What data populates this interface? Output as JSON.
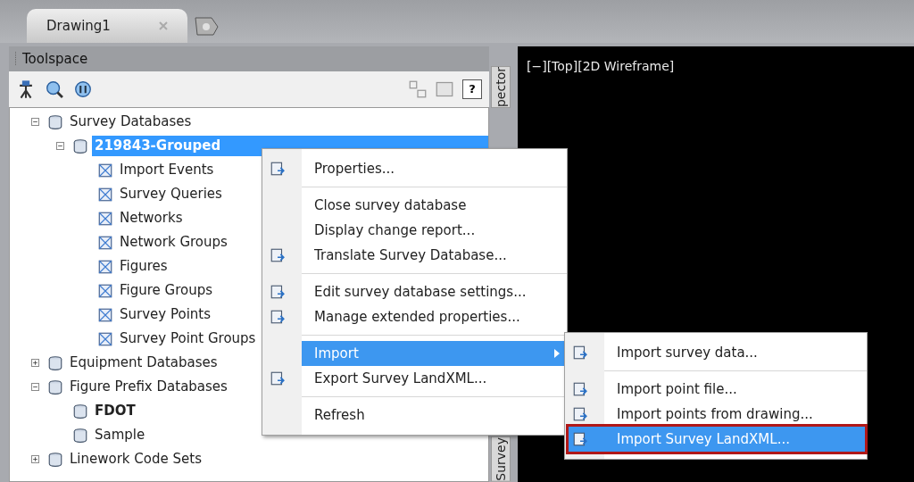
{
  "tabs": [
    {
      "label": "Drawing1",
      "selected": true
    }
  ],
  "toolspace": {
    "title": "Toolspace",
    "help": "?",
    "tree": [
      {
        "label": "Survey Databases",
        "expanded": true,
        "selected": false,
        "children": [
          {
            "label": "219843-Grouped",
            "expanded": true,
            "selected": true,
            "children": [
              {
                "label": "Import Events",
                "selected": false
              },
              {
                "label": "Survey Queries",
                "selected": false
              },
              {
                "label": "Networks",
                "selected": false
              },
              {
                "label": "Network Groups",
                "selected": false
              },
              {
                "label": "Figures",
                "selected": false
              },
              {
                "label": "Figure Groups",
                "selected": false
              },
              {
                "label": "Survey Points",
                "selected": false
              },
              {
                "label": "Survey Point Groups",
                "selected": false
              }
            ]
          }
        ]
      },
      {
        "label": "Equipment Databases",
        "expanded": false,
        "selected": false
      },
      {
        "label": "Figure Prefix Databases",
        "expanded": true,
        "selected": false,
        "children": [
          {
            "label": "FDOT",
            "selected": false,
            "current": true
          },
          {
            "label": "Sample",
            "selected": false,
            "current": false
          }
        ]
      },
      {
        "label": "Linework Code Sets",
        "expanded": false,
        "selected": false
      }
    ]
  },
  "side_tabs": [
    "pector",
    "Survey"
  ],
  "viewport": {
    "label": "[−][Top][2D Wireframe]"
  },
  "context_menu": {
    "groups": [
      [
        {
          "label": "Properties...",
          "selected": false,
          "submenu": false
        }
      ],
      [
        {
          "label": "Close survey database",
          "selected": false,
          "submenu": false
        },
        {
          "label": "Display change report...",
          "selected": false,
          "submenu": false
        },
        {
          "label": "Translate Survey Database...",
          "selected": false,
          "submenu": false
        }
      ],
      [
        {
          "label": "Edit survey database settings...",
          "selected": false,
          "submenu": false
        },
        {
          "label": "Manage extended properties...",
          "selected": false,
          "submenu": false
        }
      ],
      [
        {
          "label": "Import",
          "selected": true,
          "submenu": true
        },
        {
          "label": "Export Survey LandXML...",
          "selected": false,
          "submenu": false
        }
      ],
      [
        {
          "label": "Refresh",
          "selected": false,
          "submenu": false
        }
      ]
    ]
  },
  "submenu": {
    "groups": [
      [
        {
          "label": "Import survey data...",
          "selected": false,
          "outlined": false
        }
      ],
      [
        {
          "label": "Import point file...",
          "selected": false,
          "outlined": false
        },
        {
          "label": "Import points from drawing...",
          "selected": false,
          "outlined": false
        },
        {
          "label": "Import Survey LandXML...",
          "selected": true,
          "outlined": true
        }
      ]
    ]
  }
}
